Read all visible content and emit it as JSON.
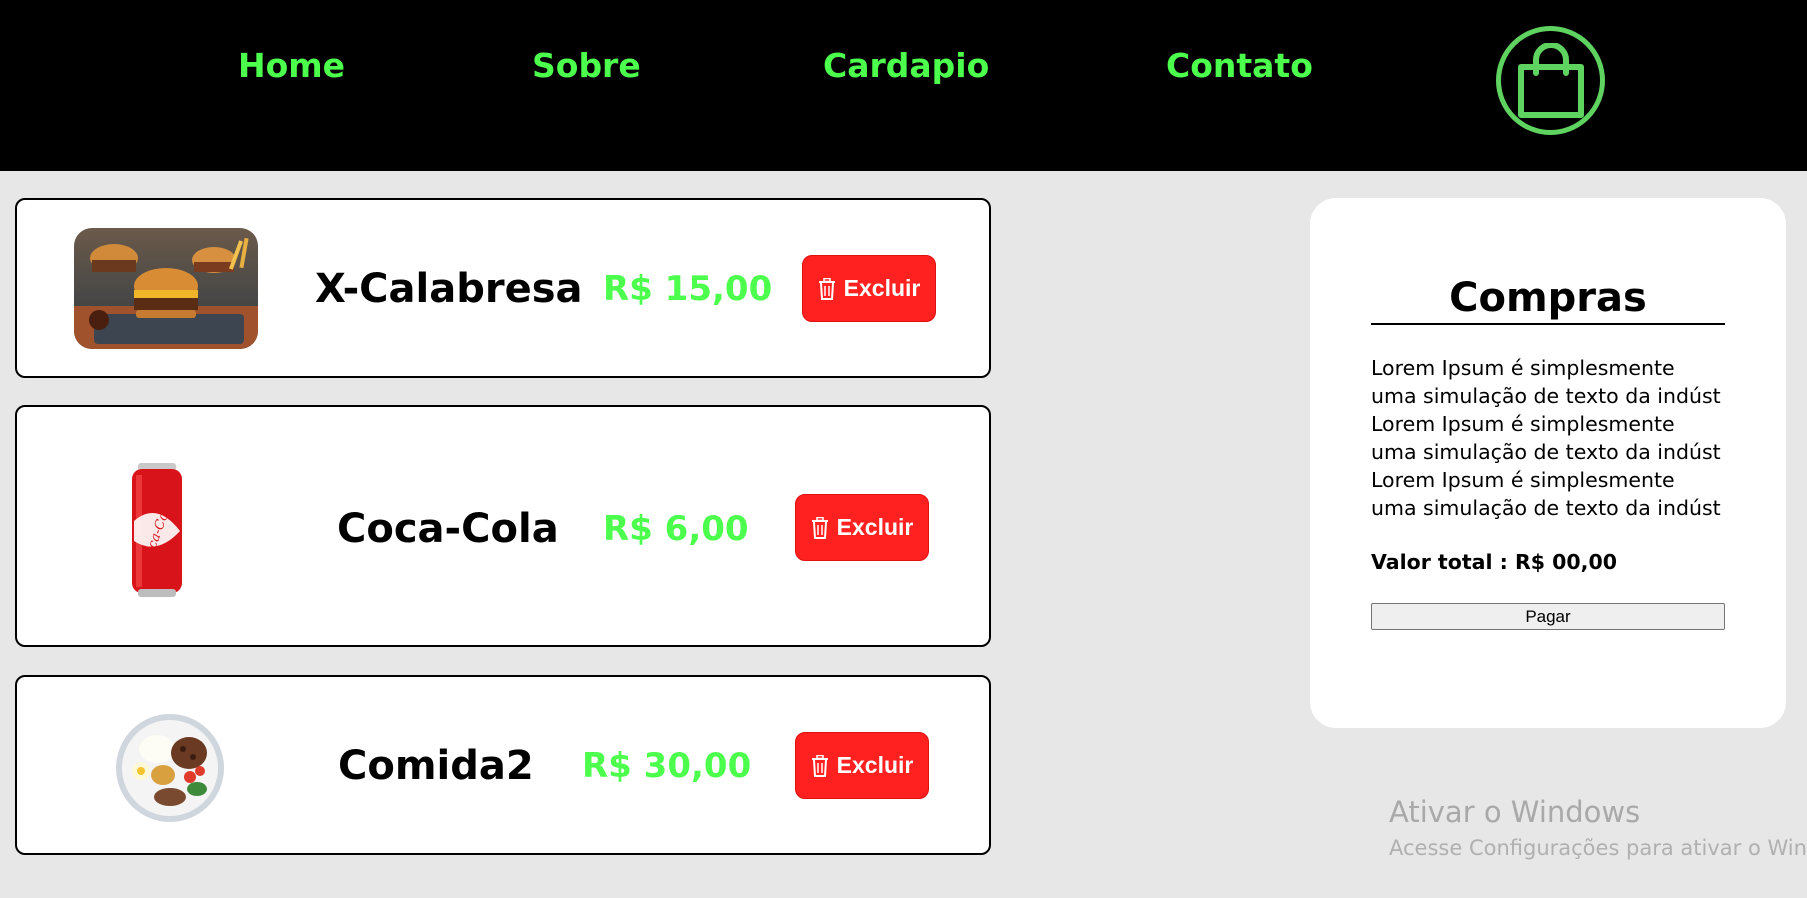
{
  "nav": {
    "items": [
      {
        "label": "Home"
      },
      {
        "label": "Sobre"
      },
      {
        "label": "Cardapio"
      },
      {
        "label": "Contato"
      }
    ],
    "cart_icon": "shopping-bag-icon",
    "accent_color": "#4cff4c"
  },
  "cart_items": [
    {
      "name": "X-Calabresa",
      "price": "R$ 15,00",
      "delete_label": "Excluir",
      "image": "burger-image"
    },
    {
      "name": "Coca-Cola",
      "price": "R$ 6,00",
      "delete_label": "Excluir",
      "image": "coca-cola-can-image"
    },
    {
      "name": "Comida2",
      "price": "R$ 30,00",
      "delete_label": "Excluir",
      "image": "food-plate-image"
    }
  ],
  "delete_icon": "trash-icon",
  "delete_color": "#ff2020",
  "summary": {
    "title": "Compras",
    "description": "Lorem Ipsum é simplesmente uma simulação de texto da indúst Lorem Ipsum é simplesmente uma simulação de texto da indúst Lorem Ipsum é simplesmente uma simulação de texto da indúst",
    "total_label": "Valor total : R$ 00,00",
    "pay_label": "Pagar"
  },
  "watermark": {
    "title": "Ativar o Windows",
    "subtitle": "Acesse Configurações para ativar o Windows."
  }
}
